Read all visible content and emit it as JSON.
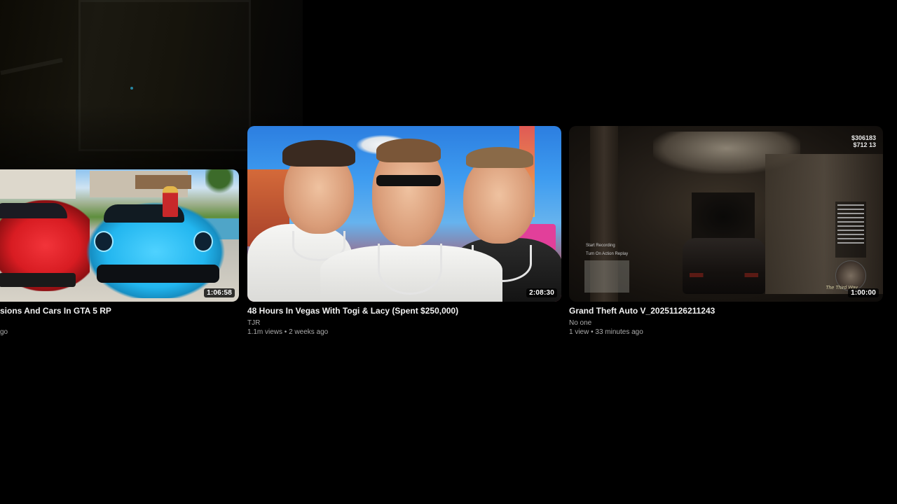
{
  "videos": [
    {
      "title": "sions And Cars In GTA 5 RP",
      "channel": "",
      "meta_partial": "go",
      "duration": "1:06:58"
    },
    {
      "title": "48 Hours In Vegas With Togi & Lacy (Spent $250,000)",
      "channel": "TJR",
      "meta": "1.1m views • 2 weeks ago",
      "duration": "2:08:30"
    },
    {
      "title": "Grand Theft Auto V_20251126211243",
      "channel": "No one",
      "meta": "1 view • 33 minutes ago",
      "duration": "1:00:00",
      "hud": {
        "money_top": "$306183",
        "money_sub": "$712 13",
        "menu_item_1": "Start Recording",
        "menu_item_2": "Turn On Action Replay",
        "watermark": "The Third Way"
      }
    }
  ],
  "colors": {
    "background": "#000000",
    "title_text": "#f1f1f1",
    "meta_text": "#aaaaaa"
  }
}
